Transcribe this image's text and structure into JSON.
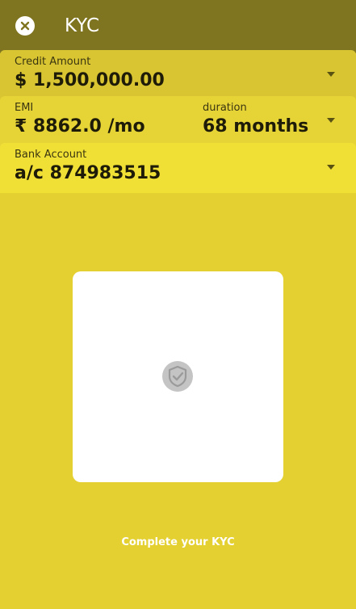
{
  "header": {
    "title": "KYC",
    "close_icon": "close-icon"
  },
  "credit": {
    "label": "Credit Amount",
    "value": "$ 1,500,000.00"
  },
  "emi": {
    "label": "EMI",
    "value": "₹ 8862.0 /mo",
    "duration_label": "duration",
    "duration_value": "68 months"
  },
  "bank": {
    "label": "Bank Account",
    "value": "a/c 874983515"
  },
  "kyc": {
    "icon": "shield-check-icon",
    "cta": "Complete your KYC"
  },
  "colors": {
    "header": "#7f7420",
    "background": "#e4d031",
    "card_box": "#ffffff"
  }
}
